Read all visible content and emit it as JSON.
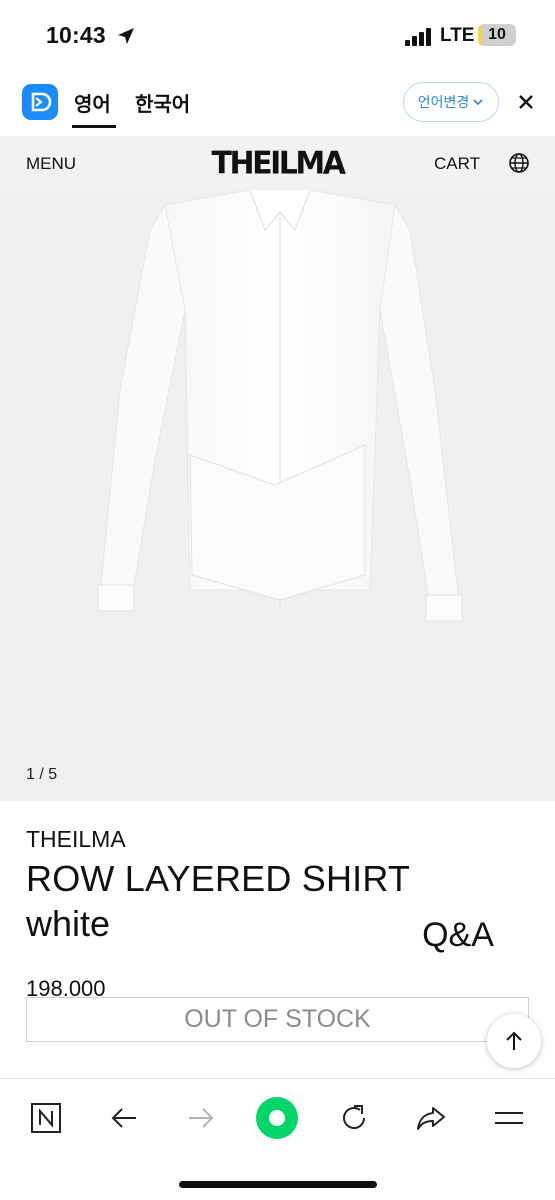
{
  "status_bar": {
    "time": "10:43",
    "network": "LTE",
    "battery": "10",
    "battery_level": 0.1
  },
  "translate_bar": {
    "tabs": [
      {
        "label": "영어",
        "active": true
      },
      {
        "label": "한국어",
        "active": false
      }
    ],
    "change_language_label": "언어변경",
    "close_icon": "close-icon"
  },
  "site_header": {
    "menu_label": "MENU",
    "brand": "THEILMA",
    "cart_label": "CART",
    "language_icon": "globe-icon"
  },
  "gallery": {
    "counter": "1 / 5"
  },
  "product": {
    "brand": "THEILMA",
    "name": "ROW LAYERED SHIRT",
    "color": "white",
    "price": "198.000",
    "qa_label": "Q&A",
    "stock_status": "OUT OF STOCK"
  },
  "toolbar": {
    "items": [
      "n-home-icon",
      "back-arrow-icon",
      "forward-arrow-icon",
      "green-dot-icon",
      "reload-icon",
      "share-icon",
      "menu-icon"
    ]
  },
  "colors": {
    "header_bg": "#f2f2f2",
    "gallery_bg": "#f0f0f0",
    "accent_blue": "#2e8ad8",
    "green": "#00d56a"
  }
}
